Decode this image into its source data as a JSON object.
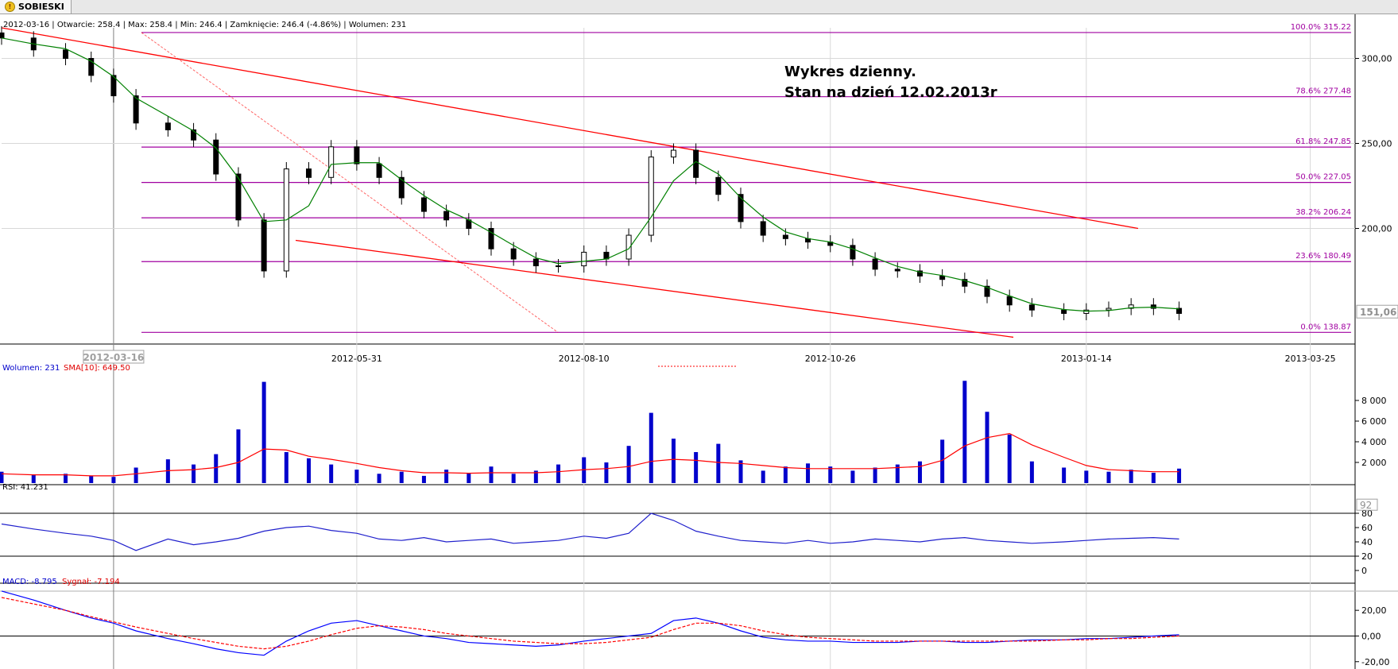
{
  "tab": {
    "label": "SOBIESKI",
    "icon": "warning-icon"
  },
  "info_bar": "2012-03-16 | Otwarcie: 258.4 | Max: 258.4 | Min: 246.4 | Zamknięcie: 246.4 (-4.86%)  | Wolumen: 231",
  "annotation": {
    "line1": "Wykres dzienny.",
    "line2": "Stan na dzień 12.02.2013r"
  },
  "price_badge": "151,06",
  "date_badge": "2012-03-16",
  "rsi_badge": "92",
  "colors": {
    "candle": "#000000",
    "ma": "#008000",
    "trend": "#ff0000",
    "fib": "#a000a0",
    "volume": "#0000cc",
    "sma": "#ff0000",
    "rsi": "#2020cc",
    "macd": "#0000ff",
    "signal": "#ff0000"
  },
  "chart_data": [
    {
      "type": "candlestick",
      "title": "",
      "ylim": [
        132,
        318
      ],
      "yticks": [
        "200,00",
        "250,00",
        "300,00"
      ],
      "xticks": [
        "2012-05-31",
        "2012-08-10",
        "2012-10-26",
        "2013-01-14",
        "2013-03-25"
      ],
      "series": [
        {
          "name": "close",
          "x": [
            "2012-02-10",
            "2012-02-20",
            "2012-03-01",
            "2012-03-09",
            "2012-03-16",
            "2012-03-23",
            "2012-04-02",
            "2012-04-10",
            "2012-04-17",
            "2012-04-24",
            "2012-05-02",
            "2012-05-09",
            "2012-05-16",
            "2012-05-23",
            "2012-05-31",
            "2012-06-07",
            "2012-06-14",
            "2012-06-21",
            "2012-06-28",
            "2012-07-05",
            "2012-07-12",
            "2012-07-19",
            "2012-07-26",
            "2012-08-02",
            "2012-08-10",
            "2012-08-17",
            "2012-08-24",
            "2012-08-31",
            "2012-09-07",
            "2012-09-14",
            "2012-09-21",
            "2012-09-28",
            "2012-10-05",
            "2012-10-12",
            "2012-10-19",
            "2012-10-26",
            "2012-11-02",
            "2012-11-09",
            "2012-11-16",
            "2012-11-23",
            "2012-11-30",
            "2012-12-07",
            "2012-12-14",
            "2012-12-21",
            "2012-12-28",
            "2013-01-07",
            "2013-01-14",
            "2013-01-21",
            "2013-01-28",
            "2013-02-04",
            "2013-02-12"
          ],
          "values": [
            312,
            305,
            300,
            290,
            278,
            262,
            258,
            252,
            232,
            205,
            175,
            235,
            230,
            248,
            238,
            230,
            218,
            210,
            205,
            200,
            188,
            182,
            178,
            178,
            186,
            182,
            196,
            242,
            246,
            230,
            220,
            204,
            196,
            194,
            192,
            190,
            182,
            176,
            175,
            172,
            170,
            166,
            160,
            155,
            152,
            150,
            152,
            153,
            155,
            153,
            150
          ]
        }
      ],
      "fibonacci": [
        {
          "label": "100.0% 315.22",
          "value": 315.22
        },
        {
          "label": "78.6% 277.48",
          "value": 277.48
        },
        {
          "label": "61.8% 247.85",
          "value": 247.85
        },
        {
          "label": "50.0% 227.05",
          "value": 227.05
        },
        {
          "label": "38.2% 206.24",
          "value": 206.24
        },
        {
          "label": "23.6% 180.49",
          "value": 180.49
        },
        {
          "label": "0.0% 138.87",
          "value": 138.87
        }
      ]
    },
    {
      "type": "bar",
      "label": "Wolumen: 231",
      "sma_label": "SMA[10]: 649.50",
      "ylim": [
        0,
        10000
      ],
      "yticks": [
        "2 000",
        "4 000",
        "6 000",
        "8 000"
      ],
      "values": [
        1100,
        800,
        900,
        700,
        600,
        1500,
        2300,
        1800,
        2800,
        5200,
        9800,
        3000,
        2400,
        1800,
        1300,
        900,
        1100,
        700,
        1300,
        1000,
        1600,
        900,
        1200,
        1800,
        2500,
        2000,
        3600,
        6800,
        4300,
        3000,
        3800,
        2200,
        1200,
        1600,
        1900,
        1600,
        1200,
        1500,
        1800,
        2100,
        4200,
        9900,
        6900,
        4700,
        2100,
        1500,
        1200,
        1100,
        1300,
        1000,
        1400
      ],
      "sma": [
        900,
        800,
        800,
        700,
        700,
        900,
        1200,
        1300,
        1500,
        2000,
        3300,
        3200,
        2600,
        2300,
        1900,
        1500,
        1200,
        1000,
        1000,
        950,
        1000,
        1000,
        1000,
        1100,
        1300,
        1400,
        1600,
        2100,
        2300,
        2200,
        2000,
        1900,
        1700,
        1500,
        1400,
        1400,
        1400,
        1400,
        1500,
        1600,
        2200,
        3600,
        4400,
        4800,
        3700,
        2500,
        1700,
        1300,
        1200,
        1100,
        1100
      ]
    },
    {
      "type": "line",
      "label": "RSI: 41.231",
      "ylim": [
        0,
        100
      ],
      "yticks": [
        "0",
        "20",
        "40",
        "60",
        "80"
      ],
      "values": [
        65,
        58,
        52,
        48,
        42,
        28,
        44,
        36,
        40,
        45,
        55,
        60,
        62,
        56,
        52,
        44,
        42,
        46,
        40,
        42,
        44,
        38,
        40,
        42,
        48,
        45,
        52,
        80,
        70,
        55,
        48,
        42,
        40,
        38,
        42,
        38,
        40,
        44,
        42,
        40,
        44,
        46,
        42,
        40,
        38,
        40,
        42,
        44,
        45,
        46,
        44
      ]
    },
    {
      "type": "line",
      "label_macd": "MACD: -8.795",
      "label_signal": "Sygnał: -7.194",
      "ylim": [
        -22,
        30
      ],
      "yticks": [
        "-20,00",
        "0,00",
        "20,00"
      ],
      "macd": [
        35,
        28,
        20,
        14,
        10,
        4,
        -2,
        -6,
        -10,
        -13,
        -15,
        -4,
        4,
        10,
        12,
        8,
        4,
        0,
        -2,
        -5,
        -6,
        -7,
        -8,
        -7,
        -4,
        -2,
        0,
        2,
        12,
        14,
        10,
        4,
        -1,
        -3,
        -4,
        -4,
        -5,
        -5,
        -5,
        -4,
        -4,
        -5,
        -5,
        -4,
        -3,
        -3,
        -2,
        -2,
        -1,
        0,
        1
      ],
      "signal": [
        30,
        25,
        20,
        15,
        11,
        7,
        2,
        -2,
        -5,
        -8,
        -10,
        -8,
        -4,
        1,
        6,
        8,
        7,
        5,
        2,
        0,
        -2,
        -4,
        -5,
        -6,
        -6,
        -5,
        -3,
        -1,
        5,
        10,
        10,
        8,
        4,
        1,
        -1,
        -2,
        -3,
        -4,
        -4,
        -4,
        -4,
        -4,
        -4,
        -4,
        -4,
        -3,
        -3,
        -2,
        -2,
        -1,
        0
      ]
    }
  ]
}
